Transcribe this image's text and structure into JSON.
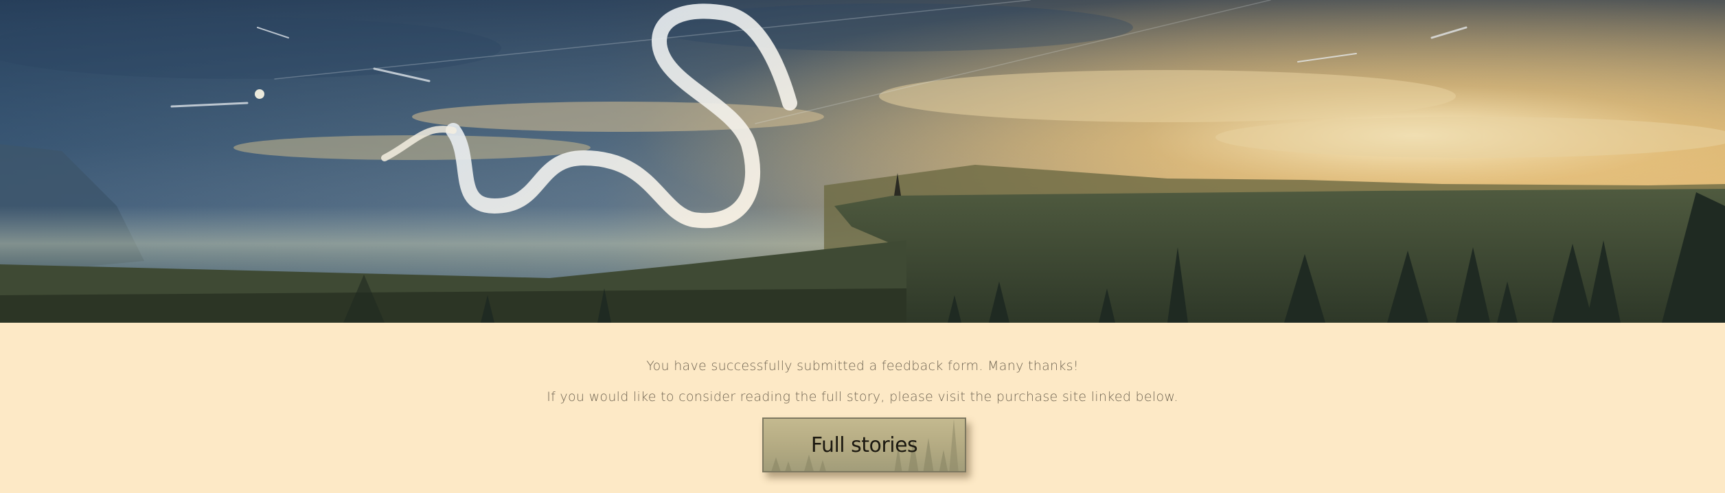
{
  "hero": {
    "image": "banner-landscape-dragon-illustration"
  },
  "message": {
    "line1": "You have successfully submitted a feedback form. Many thanks!",
    "line2": "If you would like to consider reading the full story, please visit the purchase site linked below."
  },
  "button": {
    "label": "Full stories"
  },
  "colors": {
    "background": "#fde9c6",
    "text": "#6f6452",
    "button_bg": "#b3aa82",
    "button_border": "#7d7860"
  }
}
